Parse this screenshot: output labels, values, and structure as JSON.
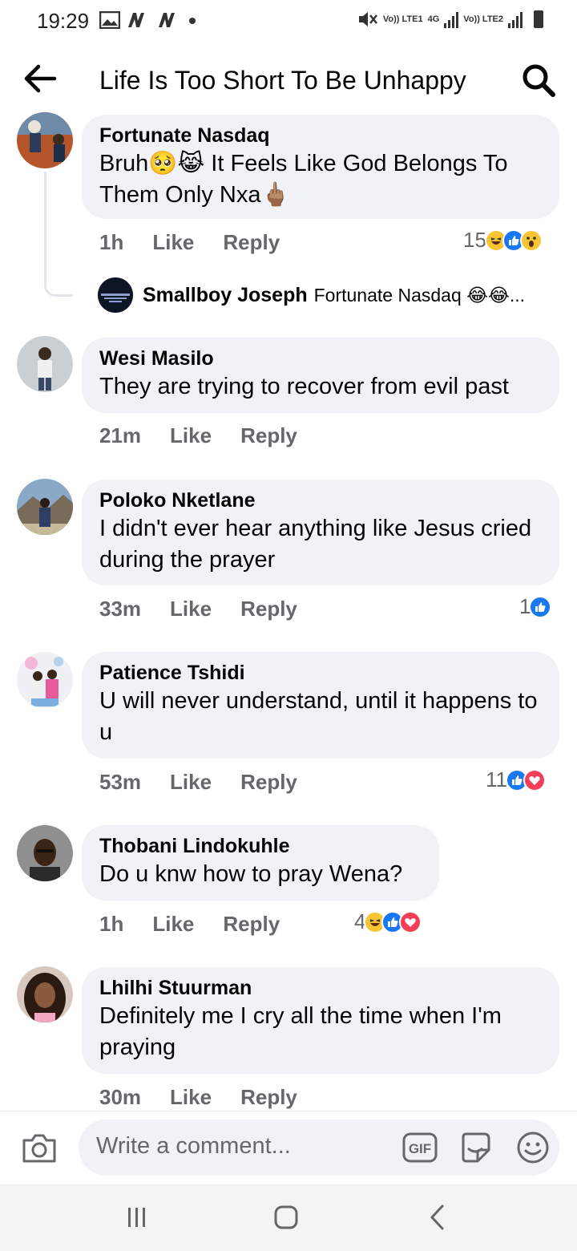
{
  "status_bar": {
    "time": "19:29",
    "network_left": "Vo)) LTE1",
    "network_mid": "4G",
    "network_right": "Vo)) LTE2"
  },
  "header": {
    "title": "Life Is Too Short To Be Unhappy"
  },
  "comments": [
    {
      "name": "Fortunate Nasdaq",
      "text": "Bruh🥺😹 It Feels Like God Belongs To Them Only Nxa🖕🏽",
      "time": "1h",
      "like": "Like",
      "reply": "Reply",
      "reaction_count": "15",
      "reactions": [
        "haha",
        "like",
        "wow"
      ]
    },
    {
      "name": "Wesi Masilo",
      "text": "They are trying to recover from evil past",
      "time": "21m",
      "like": "Like",
      "reply": "Reply"
    },
    {
      "name": "Poloko Nketlane",
      "text": "I didn't ever hear anything like Jesus cried during the prayer",
      "time": "33m",
      "like": "Like",
      "reply": "Reply",
      "reaction_count": "1",
      "reactions": [
        "like"
      ]
    },
    {
      "name": "Patience Tshidi",
      "text": "U will never understand, until it happens to u",
      "time": "53m",
      "like": "Like",
      "reply": "Reply",
      "reaction_count": "11",
      "reactions": [
        "like",
        "love"
      ]
    },
    {
      "name": "Thobani Lindokuhle",
      "text": "Do u knw how to pray Wena?",
      "time": "1h",
      "like": "Like",
      "reply": "Reply",
      "reaction_count": "4",
      "reactions": [
        "haha",
        "like",
        "love"
      ]
    },
    {
      "name": "Lhilhi Stuurman",
      "text": "Definitely me I cry all the time when I'm praying",
      "time": "30m",
      "like": "Like",
      "reply": "Reply"
    }
  ],
  "reply_preview": {
    "name": "Smallboy Joseph",
    "text": "Fortunate Nasdaq 😂😂...",
    "avatar_text": "As long as you're not money"
  },
  "composer": {
    "placeholder": "Write a comment...",
    "gif_label": "GIF"
  },
  "colors": {
    "bubble": "#f0f2f5",
    "secondary_text": "#65676b",
    "like_blue": "#1877f2",
    "love_red": "#f33e58",
    "haha_yellow": "#f7c433"
  }
}
